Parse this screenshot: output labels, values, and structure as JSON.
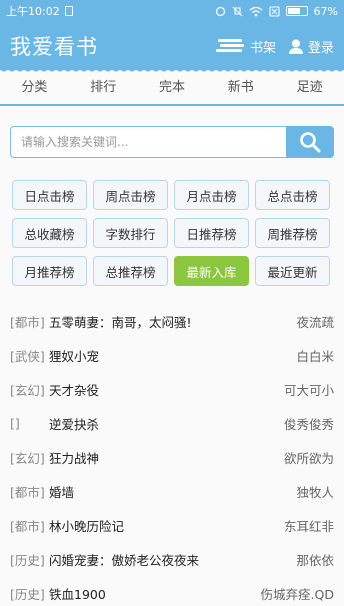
{
  "status_bar": {
    "time": "上午10:02",
    "battery_percent": "67%",
    "battery_level": 0.67
  },
  "header": {
    "title": "我爱看书",
    "bookshelf_label": "书架",
    "login_label": "登录"
  },
  "tabs": [
    {
      "label": "分类"
    },
    {
      "label": "排行"
    },
    {
      "label": "完本"
    },
    {
      "label": "新书"
    },
    {
      "label": "足迹"
    }
  ],
  "search": {
    "placeholder": "请输入搜索关键词..."
  },
  "rankings": [
    {
      "label": "日点击榜"
    },
    {
      "label": "周点击榜"
    },
    {
      "label": "月点击榜"
    },
    {
      "label": "总点击榜"
    },
    {
      "label": "总收藏榜"
    },
    {
      "label": "字数排行"
    },
    {
      "label": "日推荐榜"
    },
    {
      "label": "周推荐榜"
    },
    {
      "label": "月推荐榜"
    },
    {
      "label": "总推荐榜"
    },
    {
      "label": "最新入库",
      "active": true
    },
    {
      "label": "最近更新"
    }
  ],
  "books": [
    {
      "category": "[都市]",
      "title": "五零萌妻：南哥，太闷骚!",
      "author": "夜流疏"
    },
    {
      "category": "[武侠]",
      "title": "狸奴小宠",
      "author": "白白米"
    },
    {
      "category": "[玄幻]",
      "title": "天才杂役",
      "author": "可大可小"
    },
    {
      "category": "[]",
      "title": "逆爱抉杀",
      "author": "俊秀俊秀"
    },
    {
      "category": "[玄幻]",
      "title": "狂力战神",
      "author": "欲所欲为"
    },
    {
      "category": "[都市]",
      "title": "婚墙",
      "author": "独牧人"
    },
    {
      "category": "[都市]",
      "title": "林小晚历险记",
      "author": "东耳红非"
    },
    {
      "category": "[历史]",
      "title": "闪婚宠妻：傲娇老公夜夜来",
      "author": "那依依"
    },
    {
      "category": "[历史]",
      "title": "铁血1900",
      "author": "伤城弃痊.QD"
    }
  ]
}
